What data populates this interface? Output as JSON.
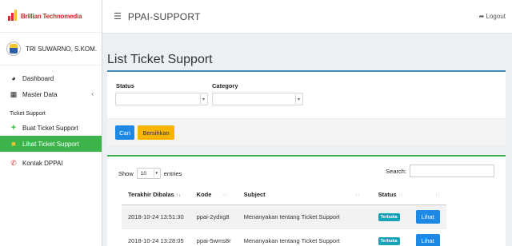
{
  "brand": {
    "name": "Brillian Technomedia"
  },
  "user": {
    "name": "TRI SUWARNO, S.KOM."
  },
  "sidebar": {
    "items": [
      {
        "label": "Dashboard",
        "icon": "dashboard-icon"
      },
      {
        "label": "Master Data",
        "icon": "grid-icon"
      }
    ],
    "section_label": "Ticket Support",
    "ticket_items": [
      {
        "label": "Buat Ticket Support",
        "icon": "plus-icon"
      },
      {
        "label": "Lihat Ticket Support",
        "icon": "ticket-icon"
      },
      {
        "label": "Kontak DPPAI",
        "icon": "phone-icon"
      }
    ]
  },
  "header": {
    "title": "PPAI-SUPPORT",
    "logout_label": "Logout"
  },
  "main": {
    "page_title": "List Ticket Support",
    "filter": {
      "status_label": "Status",
      "category_label": "Category",
      "status_value": "",
      "category_value": "",
      "search_button": "Cari",
      "clear_button": "Bersihkan"
    },
    "table": {
      "show_label": "Show",
      "length_value": "10",
      "entries_label": "entries",
      "search_label": "Search:",
      "search_value": "",
      "columns": [
        "Terakhir Dibalas",
        "Kode",
        "Subject",
        "Status",
        ""
      ],
      "rows": [
        {
          "date": "2018-10-24 13:51:30",
          "code": "ppai-2ydxg8",
          "subject": "Menanyakan tentang Ticket Support",
          "status": "Terbuka",
          "action": "Lihat"
        },
        {
          "date": "2018-10-24 13:28:05",
          "code": "ppai-5wms8r",
          "subject": "Menanyakan tentang Ticket Support",
          "status": "Terbuka",
          "action": "Lihat"
        }
      ]
    }
  },
  "colors": {
    "accent": "#3cb44b",
    "primary": "#1e88e5",
    "warning": "#f7b500",
    "badge": "#17a2b8",
    "brand": "#c62828"
  }
}
